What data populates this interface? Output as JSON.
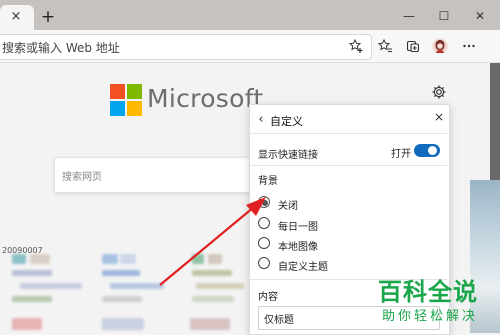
{
  "browser": {
    "tab_close": "×",
    "new_tab": "+",
    "window": {
      "minimize": "—",
      "maximize": "☐",
      "close": "✕"
    },
    "address_placeholder": "搜索或输入 Web 地址",
    "toolbar_icons": [
      "favorite-add-icon",
      "favorites-icon",
      "collections-icon",
      "profile-avatar",
      "more-icon"
    ]
  },
  "newtab": {
    "brand": "Microsoft",
    "search_placeholder": "搜索网页",
    "date_code": "20090007",
    "settings_icon": "gear-icon"
  },
  "customize_panel": {
    "back": "‹",
    "title": "自定义",
    "close": "×",
    "quick_links_label": "显示快速链接",
    "quick_links_state": "打开",
    "quick_links_on": true,
    "background_heading": "背景",
    "background_options": [
      "关闭",
      "每日一图",
      "本地图像",
      "自定义主题"
    ],
    "background_selected": "关闭",
    "content_heading": "内容",
    "content_value": "仅标题"
  },
  "watermark": {
    "title": "百科全说",
    "subtitle": "助你轻松解决",
    "color": "#1aa64a"
  },
  "colors": {
    "toggle_on": "#0f6cbd",
    "annotation_arrow": "#e02020",
    "ms_red": "#f25022",
    "ms_green": "#7fba00",
    "ms_blue": "#00a4ef",
    "ms_yellow": "#ffb900"
  }
}
